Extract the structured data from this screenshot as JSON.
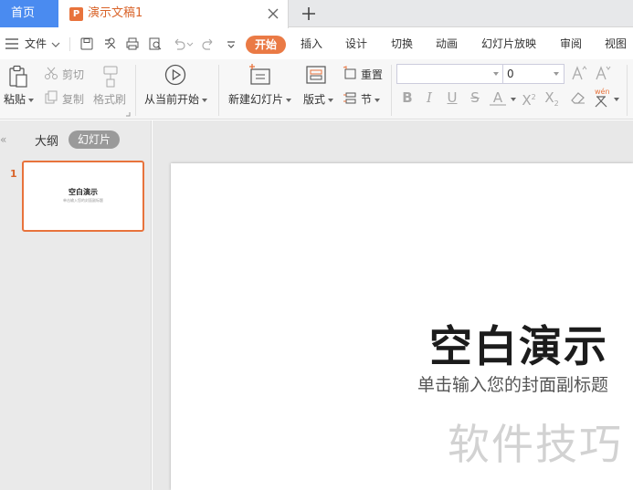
{
  "tabs": {
    "home": "首页",
    "doc_icon": "P",
    "doc_title": "演示文稿1"
  },
  "menu": {
    "file": "文件",
    "items": [
      "开始",
      "插入",
      "设计",
      "切换",
      "动画",
      "幻灯片放映",
      "审阅",
      "视图"
    ]
  },
  "ribbon": {
    "paste": "粘贴",
    "cut": "剪切",
    "copy": "复制",
    "format_painter": "格式刷",
    "from_current": "从当前开始",
    "new_slide": "新建幻灯片",
    "layout": "版式",
    "reset": "重置",
    "section": "节",
    "font_name": "",
    "font_size": "0",
    "pinyin": "wén"
  },
  "left_panel": {
    "outline_tab": "大纲",
    "slides_tab": "幻灯片",
    "slide_number": "1",
    "thumb_title": "空白演示",
    "thumb_subtitle": "单击输入您的封面副标题"
  },
  "slide": {
    "title": "空白演示",
    "subtitle": "单击输入您的封面副标题",
    "watermark": "软件技巧"
  },
  "colors": {
    "accent": "#e8733c",
    "home_tab": "#4a8bf0"
  }
}
